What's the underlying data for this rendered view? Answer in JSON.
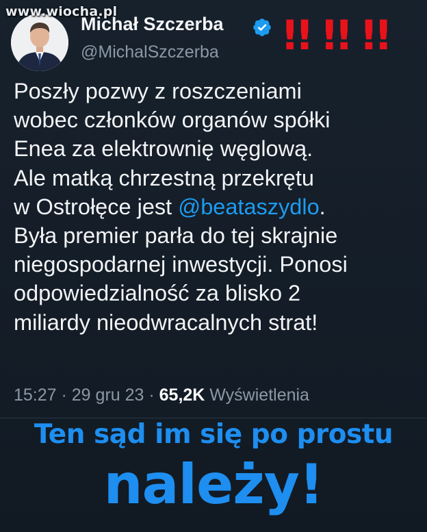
{
  "watermark": "www.wiocha.pl",
  "author": {
    "name": "Michał Szczerba",
    "handle": "@MichalSzczerba"
  },
  "overlay": {
    "exclamations": "!! !! !!"
  },
  "tweet": {
    "lines": [
      "Poszły pozwy z roszczeniami",
      "wobec członków organów spółki",
      "Enea za elektrownię węglową.",
      "Ale matką chrzestną przekrętu"
    ],
    "mention_prefix": "w Ostrołęce jest ",
    "mention": "@beataszydlo",
    "mention_suffix": ".",
    "lines_after": [
      "Była premier parła do tej skrajnie",
      "niegospodarnej inwestycji. Ponosi",
      "odpowiedzialność za blisko 2",
      "miliardy nieodwracalnych strat!"
    ]
  },
  "meta": {
    "time": "15:27",
    "sep1": " · ",
    "date": "29 gru 23",
    "sep2": " · ",
    "views_count": "65,2K",
    "views_label": " Wyświetlenia"
  },
  "caption": {
    "line1": "Ten sąd im się po prostu",
    "line2": "należy!"
  },
  "colors": {
    "background": "#15202b",
    "mention": "#1d9bf0",
    "caption": "#1e8ef0",
    "exclamation": "#e8121b",
    "verified": "#1d9bf0"
  }
}
